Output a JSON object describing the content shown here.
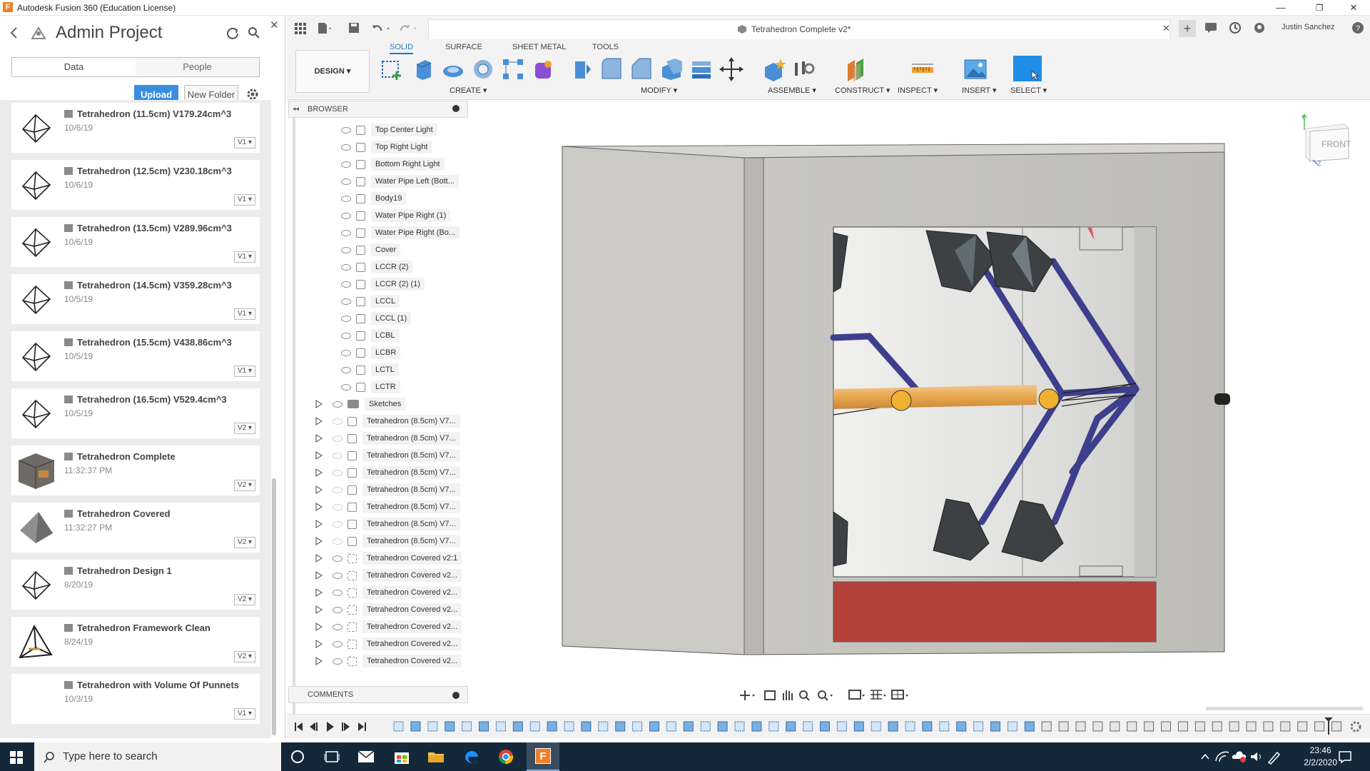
{
  "window": {
    "title": "Autodesk Fusion 360 (Education License)",
    "icon_letter": "F",
    "min": "—",
    "max": "❐",
    "close": "✕"
  },
  "data_panel": {
    "project_title": "Admin Project",
    "tabs": [
      "Data",
      "People"
    ],
    "upload_label": "Upload",
    "new_folder_label": "New Folder",
    "close_glyph": "✕",
    "files": [
      {
        "name": "Tetrahedron (11.5cm) V179.24cm^3",
        "date": "10/6/19",
        "version": "V1",
        "thumb": "wire"
      },
      {
        "name": "Tetrahedron (12.5cm) V230.18cm^3",
        "date": "10/6/19",
        "version": "V1",
        "thumb": "wire"
      },
      {
        "name": "Tetrahedron (13.5cm) V289.96cm^3",
        "date": "10/6/19",
        "version": "V1",
        "thumb": "wire"
      },
      {
        "name": "Tetrahedron (14.5cm) V359.28cm^3",
        "date": "10/5/19",
        "version": "V1",
        "thumb": "wire"
      },
      {
        "name": "Tetrahedron (15.5cm) V438.86cm^3",
        "date": "10/5/19",
        "version": "V1",
        "thumb": "wire"
      },
      {
        "name": "Tetrahedron (16.5cm) V529.4cm^3",
        "date": "10/5/19",
        "version": "V2",
        "thumb": "wire"
      },
      {
        "name": "Tetrahedron Complete",
        "date": "11:32:37 PM",
        "version": "V2",
        "thumb": "box"
      },
      {
        "name": "Tetrahedron Covered",
        "date": "11:32:27 PM",
        "version": "V2",
        "thumb": "solid"
      },
      {
        "name": "Tetrahedron Design 1",
        "date": "8/20/19",
        "version": "V2",
        "thumb": "wire"
      },
      {
        "name": "Tetrahedron Framework Clean",
        "date": "8/24/19",
        "version": "V2",
        "thumb": "frame"
      },
      {
        "name": "Tetrahedron with Volume Of Punnets",
        "date": "10/3/19",
        "version": "V1",
        "thumb": "none"
      }
    ]
  },
  "document": {
    "tab_title": "Tetrahedron Complete v2*",
    "user_name": "Justin Sanchez"
  },
  "toolbar": {
    "workspace_tabs": [
      "SOLID",
      "SURFACE",
      "SHEET METAL",
      "TOOLS"
    ],
    "design_label": "DESIGN ▾",
    "groups": [
      "CREATE ▾",
      "MODIFY ▾",
      "ASSEMBLE ▾",
      "CONSTRUCT ▾",
      "INSPECT ▾",
      "INSERT ▾",
      "SELECT ▾"
    ]
  },
  "browser": {
    "header": "BROWSER",
    "comments_label": "COMMENTS",
    "bodies": [
      "Top Center Light",
      "Top Right Light",
      "Bottom Right Light",
      "Water Pipe Left (Bott...",
      "Body19",
      "Water Pipe Right (1)",
      "Water Pipe Right (Bo...",
      "Cover",
      "LCCR (2)",
      "LCCR (2) (1)",
      "LCCL",
      "LCCL (1)",
      "LCBL",
      "LCBR",
      "LCTL",
      "LCTR"
    ],
    "components": [
      {
        "label": "Sketches",
        "kind": "folder"
      },
      {
        "label": "Tetrahedron (8.5cm) V7...",
        "kind": "comp-hidden"
      },
      {
        "label": "Tetrahedron (8.5cm) V7...",
        "kind": "comp-hidden"
      },
      {
        "label": "Tetrahedron (8.5cm) V7...",
        "kind": "comp-hidden"
      },
      {
        "label": "Tetrahedron (8.5cm) V7...",
        "kind": "comp-hidden"
      },
      {
        "label": "Tetrahedron (8.5cm) V7...",
        "kind": "comp-hidden"
      },
      {
        "label": "Tetrahedron (8.5cm) V7...",
        "kind": "comp-hidden"
      },
      {
        "label": "Tetrahedron (8.5cm) V7...",
        "kind": "comp-hidden"
      },
      {
        "label": "Tetrahedron (8.5cm) V7...",
        "kind": "comp-hidden"
      },
      {
        "label": "Tetrahedron Covered v2:1",
        "kind": "link"
      },
      {
        "label": "Tetrahedron Covered v2...",
        "kind": "link"
      },
      {
        "label": "Tetrahedron Covered v2...",
        "kind": "link"
      },
      {
        "label": "Tetrahedron Covered v2...",
        "kind": "link"
      },
      {
        "label": "Tetrahedron Covered v2...",
        "kind": "link"
      },
      {
        "label": "Tetrahedron Covered v2...",
        "kind": "link"
      },
      {
        "label": "Tetrahedron Covered v2...",
        "kind": "link"
      }
    ]
  },
  "viewcube": {
    "face": "FRONT",
    "axis_y": "Y",
    "axis_z": "Z"
  },
  "taskbar": {
    "search_placeholder": "Type here to search",
    "time": "23:46",
    "date": "2/2/2020"
  }
}
